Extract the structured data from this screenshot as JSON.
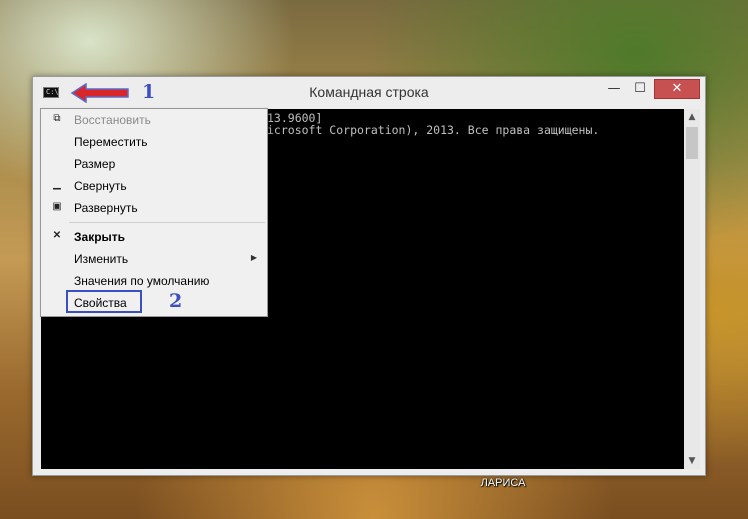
{
  "window": {
    "title": "Командная строка",
    "controls": {
      "minimize": "—",
      "maximize": "☐",
      "close": "✕"
    }
  },
  "console": {
    "line1": "13.9600]",
    "line2": "icrosoft Corporation), 2013. Все права защищены."
  },
  "system_menu": {
    "items": [
      {
        "label": "Восстановить",
        "icon": "restore-icon",
        "disabled": true
      },
      {
        "label": "Переместить",
        "icon": "",
        "disabled": false
      },
      {
        "label": "Размер",
        "icon": "",
        "disabled": false
      },
      {
        "label": "Свернуть",
        "icon": "minimize-icon",
        "disabled": false
      },
      {
        "label": "Развернуть",
        "icon": "maximize-icon",
        "disabled": false
      },
      {
        "label": "Закрыть",
        "icon": "close-icon",
        "disabled": false,
        "bold": true
      },
      {
        "label": "Изменить",
        "icon": "",
        "disabled": false,
        "submenu": true
      },
      {
        "label": "Значения по умолчанию",
        "icon": "",
        "disabled": false
      },
      {
        "label": "Свойства",
        "icon": "",
        "disabled": false,
        "highlighted": true
      }
    ]
  },
  "annotations": {
    "step1": "1",
    "step2": "2",
    "color": "#3d4ec0",
    "arrow_color": "#d9262b"
  },
  "desktop": {
    "label": "ЛАРИСА"
  }
}
